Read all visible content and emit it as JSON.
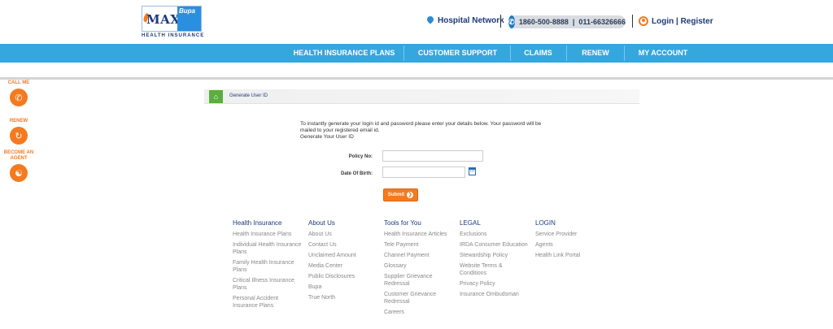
{
  "header": {
    "logo": {
      "max": "MAX",
      "bupa": "Bupa",
      "sub": "HEALTH INSURANCE"
    },
    "hospital_network": "Hospital Network",
    "phone": "1860-500-8888  |  011-66326666",
    "login": "Login | Register"
  },
  "nav": [
    "HEALTH INSURANCE PLANS",
    "CUSTOMER SUPPORT",
    "CLAIMS",
    "RENEW",
    "MY ACCOUNT"
  ],
  "side": {
    "call": "CALL ME",
    "renew": "RENEW",
    "agent": "BECOME AN AGENT"
  },
  "breadcrumb": "Generate User ID",
  "form": {
    "intro": "To instantly generate your login id and password please enter your details below. Your password will be mailed to your registered email id.",
    "heading": "Generate Your User ID",
    "policy_label": "Policy No:",
    "policy_value": "",
    "dob_label": "Date Of Birth:",
    "dob_value": "",
    "submit": "Submit"
  },
  "footer": [
    {
      "title": "Health Insurance",
      "links": [
        "Health Insurance Plans",
        "Individual Health Insurance Plans",
        "Family Health Insurance Plans",
        "Critical Illness Insurance Plans",
        "Personal Accident Insurance Plans"
      ]
    },
    {
      "title": "About Us",
      "links": [
        "About Us",
        "Contact Us",
        "Unclaimed Amount",
        "Media Center",
        "Public Disclosures",
        "Bupa",
        "True North"
      ]
    },
    {
      "title": "Tools for You",
      "links": [
        "Health Insurance Articles",
        "Tele Payment",
        "Channel Payment",
        "Glossary",
        "Supplier Grievance Redressal",
        "Customer Grievance Redressal",
        "Careers"
      ]
    },
    {
      "title": "LEGAL",
      "links": [
        "Exclusions",
        "IRDA Consumer Education",
        "Stewardship Policy",
        "Website Terms & Conditions",
        "Privacy Policy",
        "Insurance Ombudsman"
      ]
    },
    {
      "title": "LOGIN",
      "links": [
        "Service Provider",
        "Agents",
        "Health Link Portal"
      ]
    }
  ],
  "colors": {
    "nav": "#35a7df",
    "accent": "#f47a20",
    "brand": "#1b3a7a"
  }
}
